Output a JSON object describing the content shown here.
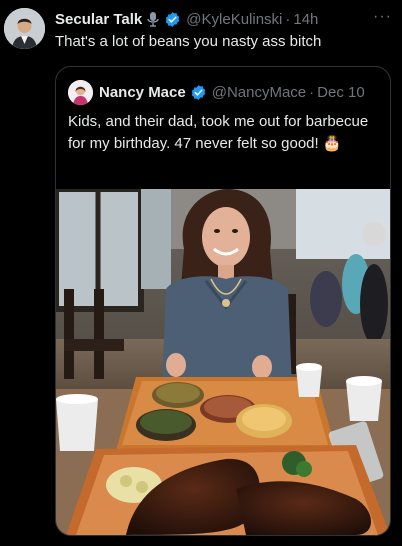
{
  "tweet": {
    "author_name": "Secular Talk",
    "author_handle": "@KyleKulinski",
    "separator": "·",
    "time": "14h",
    "text": "That's a lot of beans you nasty ass bitch",
    "more_label": "···"
  },
  "quoted_tweet": {
    "author_name": "Nancy Mace",
    "author_handle": "@NancyMace",
    "separator": "·",
    "date": "Dec 10",
    "text": "Kids, and their dad, took me out for barbecue for my birthday. 47 never felt so good! 🎂"
  },
  "colors": {
    "background": "#000000",
    "text": "#e7e9ea",
    "muted": "#71767b",
    "verified": "#1d9bf0",
    "border": "#2f3336"
  },
  "icons": [
    "microphone-icon",
    "verified-badge-icon",
    "more-icon",
    "birthday-cake-emoji"
  ]
}
